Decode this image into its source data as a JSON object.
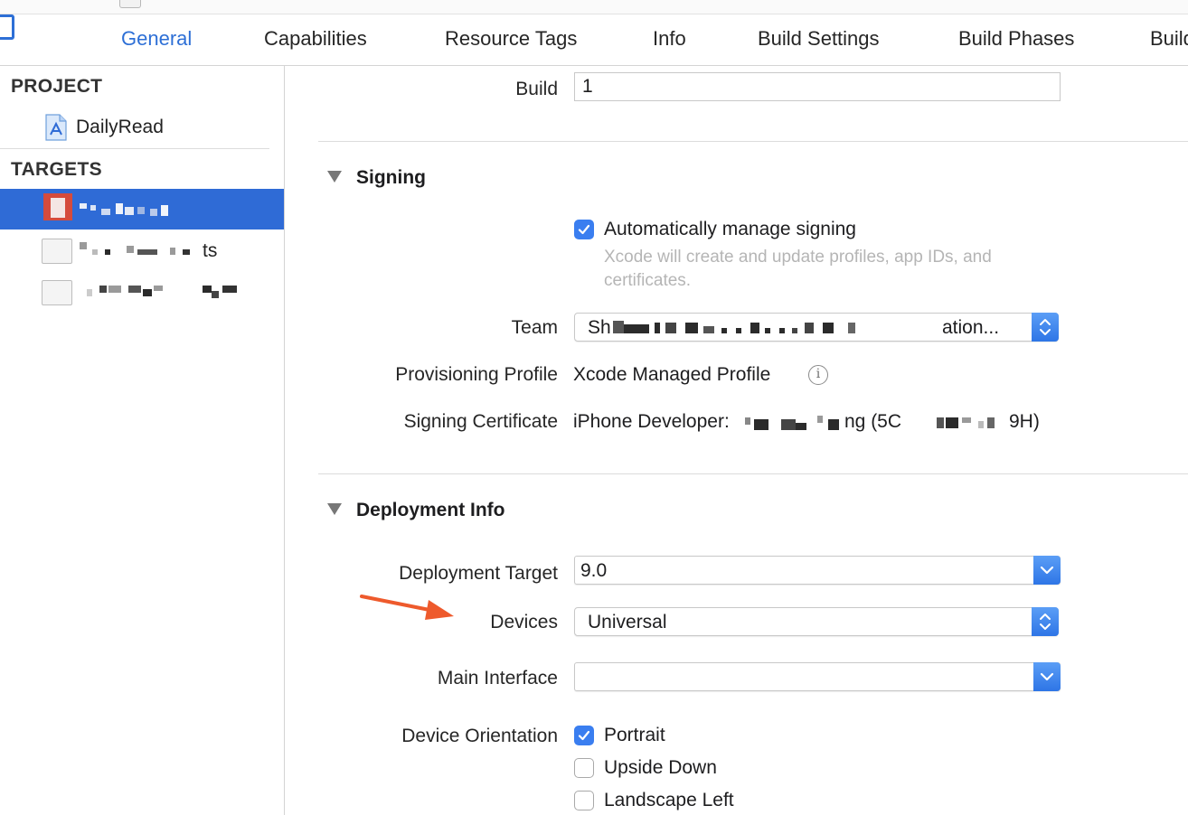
{
  "tabs": [
    {
      "label": "General",
      "active": true
    },
    {
      "label": "Capabilities",
      "active": false
    },
    {
      "label": "Resource Tags",
      "active": false
    },
    {
      "label": "Info",
      "active": false
    },
    {
      "label": "Build Settings",
      "active": false
    },
    {
      "label": "Build Phases",
      "active": false
    },
    {
      "label": "Build",
      "active": false
    }
  ],
  "sidebar": {
    "project_header": "PROJECT",
    "project_name": "DailyRead",
    "targets_header": "TARGETS",
    "target_2_suffix": "ts"
  },
  "build": {
    "label": "Build",
    "value": "1"
  },
  "signing": {
    "title": "Signing",
    "auto_label": "Automatically manage signing",
    "auto_checked": true,
    "auto_hint": "Xcode will create and update profiles, app IDs, and certificates.",
    "team_label": "Team",
    "team_value_start": "Sh",
    "team_value_end": "ation...",
    "profile_label": "Provisioning Profile",
    "profile_value": "Xcode Managed Profile",
    "cert_label": "Signing Certificate",
    "cert_prefix": "iPhone Developer:",
    "cert_mid": "ng (5C",
    "cert_end": "9H)"
  },
  "deployment": {
    "title": "Deployment Info",
    "target_label": "Deployment Target",
    "target_value": "9.0",
    "devices_label": "Devices",
    "devices_value": "Universal",
    "main_label": "Main Interface",
    "main_value": "",
    "orientation_label": "Device Orientation",
    "orientations": [
      {
        "label": "Portrait",
        "checked": true
      },
      {
        "label": "Upside Down",
        "checked": false
      },
      {
        "label": "Landscape Left",
        "checked": false
      }
    ]
  },
  "colors": {
    "accent": "#2d6fd6",
    "selection": "#2f6bd6",
    "arrow": "#ee5a2c"
  }
}
